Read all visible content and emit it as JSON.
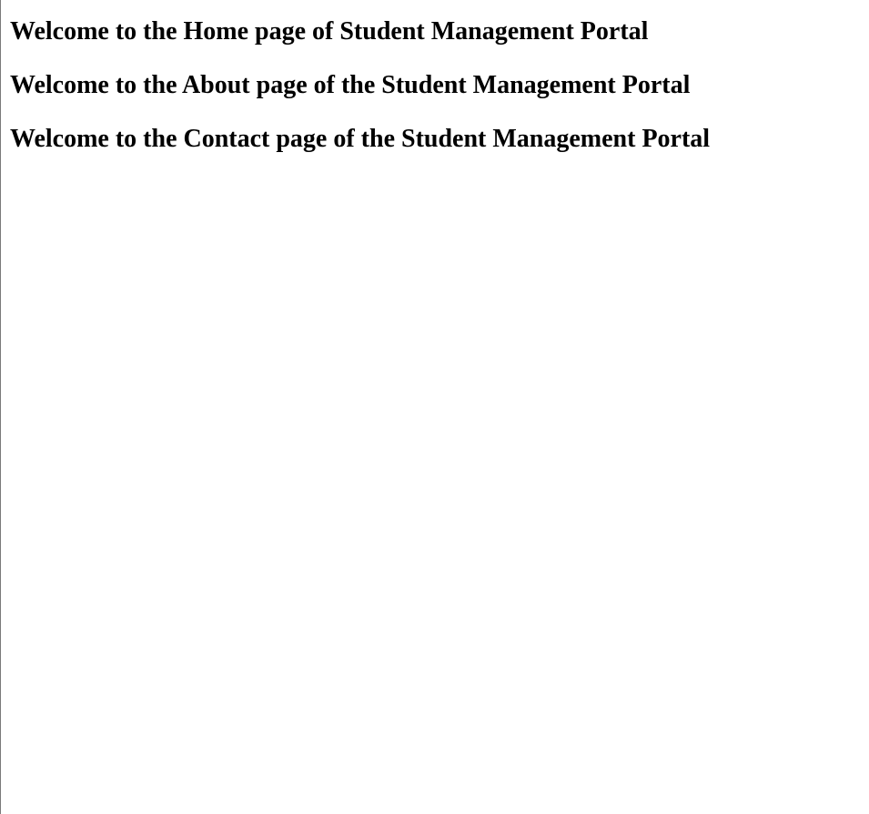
{
  "headings": {
    "home": "Welcome to the Home page of Student Management Portal",
    "about": "Welcome to the About page of the Student Management Portal",
    "contact": "Welcome to the Contact page of the Student Management Portal"
  },
  "colors": {
    "background": "#ffffff",
    "text": "#000000",
    "left_border": "#7a7a7a"
  }
}
